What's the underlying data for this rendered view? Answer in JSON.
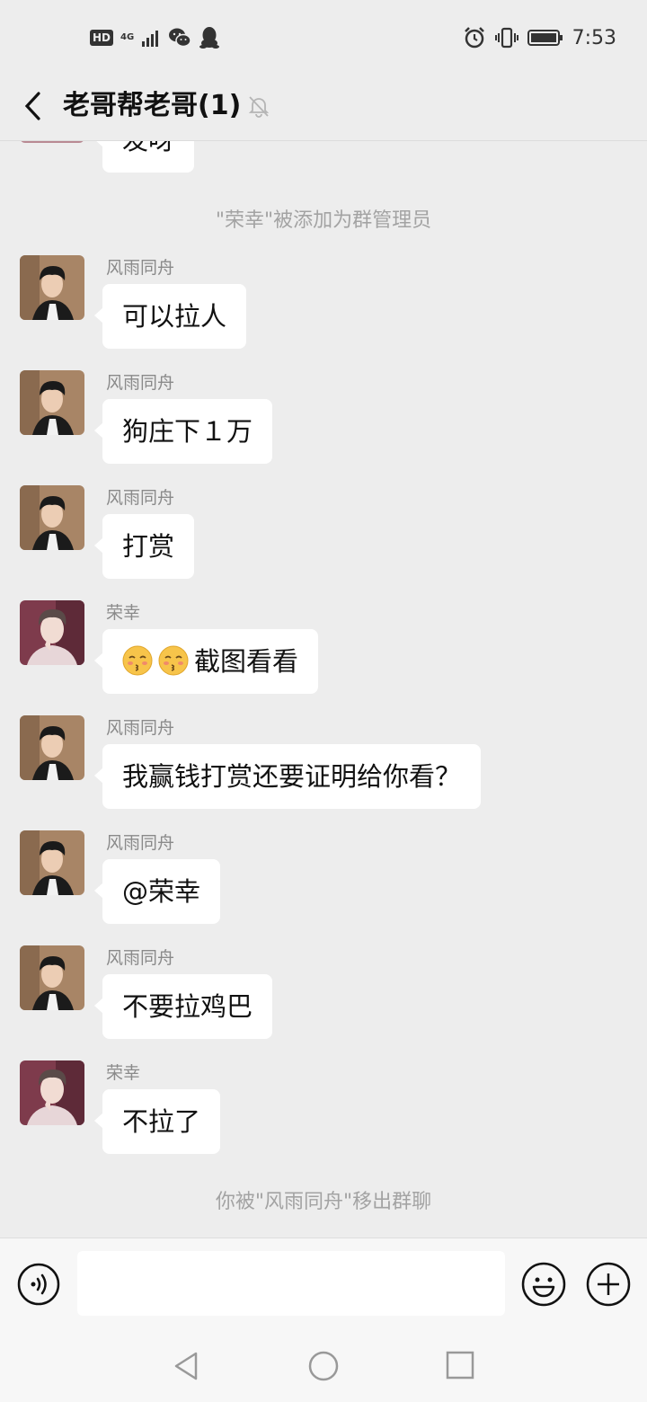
{
  "status_bar": {
    "hd": "HD",
    "network": "4G",
    "time": "7:53",
    "icons": [
      "signal-icon",
      "wechat-icon",
      "qq-icon",
      "alarm-icon",
      "vibrate-icon",
      "battery-icon"
    ]
  },
  "header": {
    "title": "老哥帮老哥(1)",
    "icons": [
      "back-icon",
      "mute-bell-icon"
    ]
  },
  "chat": {
    "partial_message": "发呀",
    "system_top": "\"荣幸\"被添加为群管理员",
    "messages": [
      {
        "sender": "风雨同舟",
        "text": "可以拉人",
        "avatar": "man-avatar"
      },
      {
        "sender": "风雨同舟",
        "text": "狗庄下１万",
        "avatar": "man-avatar"
      },
      {
        "sender": "风雨同舟",
        "text": "打赏",
        "avatar": "man-avatar"
      },
      {
        "sender": "荣幸",
        "text": "截图看看",
        "emoji_prefix": [
          "kissing-face-icon",
          "kissing-face-icon"
        ],
        "avatar": "illustrated-avatar"
      },
      {
        "sender": "风雨同舟",
        "text": "我赢钱打赏还要证明给你看？",
        "avatar": "man-avatar"
      },
      {
        "sender": "风雨同舟",
        "text": "@荣幸",
        "avatar": "man-avatar"
      },
      {
        "sender": "风雨同舟",
        "text": "不要拉鸡巴",
        "avatar": "man-avatar"
      },
      {
        "sender": "荣幸",
        "text": "不拉了",
        "avatar": "illustrated-avatar"
      }
    ],
    "system_bottom": "你被\"风雨同舟\"移出群聊"
  },
  "input_bar": {
    "icons": [
      "voice-icon",
      "emoji-icon",
      "plus-icon"
    ],
    "value": ""
  },
  "nav_bar": {
    "icons": [
      "nav-back-icon",
      "nav-home-icon",
      "nav-recent-icon"
    ]
  },
  "colors": {
    "background": "#ededed",
    "bubble": "#ffffff",
    "system_text": "#a3a3a3",
    "sender_text": "#8a8a8a"
  }
}
